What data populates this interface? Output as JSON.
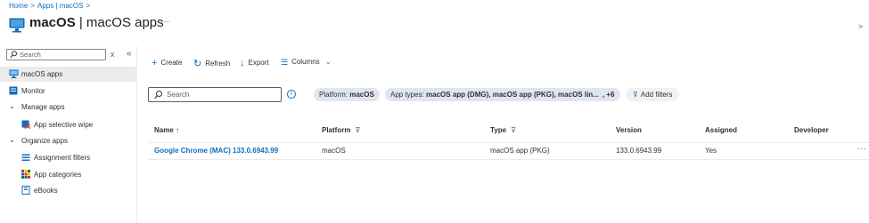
{
  "breadcrumb": {
    "home": "Home",
    "apps": "Apps | macOS",
    "sep": ">"
  },
  "header": {
    "title_bold": "macOS",
    "title_rest": " | macOS apps",
    "more": "···",
    "collapse_right": ">"
  },
  "sidebar": {
    "search_placeholder": "Search",
    "clear": "x",
    "collapse": "«",
    "items": [
      {
        "label": "macOS apps",
        "icon": "monitor-app-icon",
        "selected": true
      },
      {
        "label": "Monitor",
        "icon": "monitor-icon"
      },
      {
        "label": "Manage apps",
        "icon": "chevron-down-icon",
        "group": true
      },
      {
        "label": "App selective wipe",
        "icon": "wipe-icon"
      },
      {
        "label": "Organize apps",
        "icon": "chevron-down-icon",
        "group": true
      },
      {
        "label": "Assignment filters",
        "icon": "filter-list-icon"
      },
      {
        "label": "App categories",
        "icon": "grid-icon"
      },
      {
        "label": "eBooks",
        "icon": "book-icon"
      }
    ]
  },
  "toolbar": {
    "create": "Create",
    "refresh": "Refresh",
    "export": "Export",
    "columns": "Columns"
  },
  "filters": {
    "search_placeholder": "Search",
    "info": "i",
    "platform_label": "Platform: ",
    "platform_value": "macOS",
    "apptypes_label": "App types: ",
    "apptypes_value": "macOS app (DMG), macOS app (PKG), macOS lin...",
    "apptypes_more": ", +6",
    "add_filters": "Add filters"
  },
  "table": {
    "headers": {
      "name": "Name ↑",
      "platform": "Platform",
      "type": "Type",
      "version": "Version",
      "assigned": "Assigned",
      "developer": "Developer"
    },
    "rows": [
      {
        "name": "Google Chrome (MAC) 133.0.6943.99",
        "platform": "macOS",
        "type": "macOS app (PKG)",
        "version": "133.0.6943.99",
        "assigned": "Yes",
        "developer": "",
        "more": "···"
      }
    ]
  },
  "colors": {
    "accent": "#0f6cbd",
    "pill": "#dfe6ef",
    "selected": "#edebe9"
  }
}
